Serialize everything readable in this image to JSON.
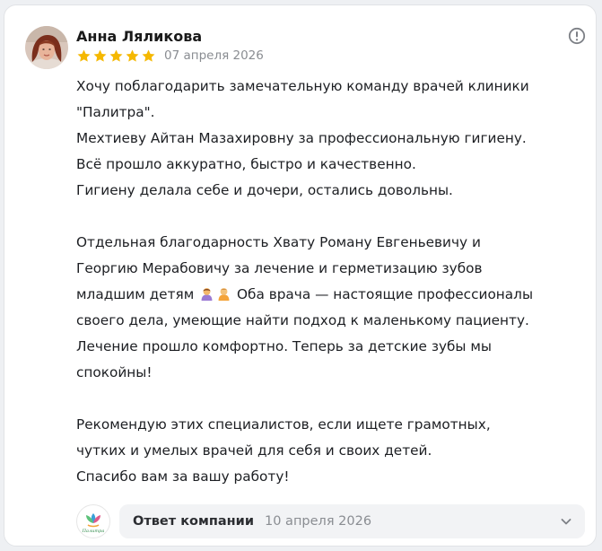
{
  "review": {
    "author": "Анна Ляликова",
    "rating": 5,
    "date": "07 апреля 2026",
    "paragraphs": [
      [
        "Хочу поблагодарить замечательную команду врачей клиники",
        "\"Палитра\".",
        "Мехтиеву Айтан Мазахировну за профессиональную гигиену.",
        "Всё прошло аккуратно, быстро и качественно.",
        "Гигиену делала себе и дочери, остались довольны."
      ],
      [
        "Отдельная благодарность Хвату Роману Евгеньевичу и",
        "Георгию Мерабовичу за лечение и герметизацию зубов",
        "младшим детям",
        "Оба врача — настоящие профессионалы",
        "своего дела, умеющие найти подход к маленькому пациенту.",
        "Лечение прошло комфортно. Теперь за детские зубы мы",
        "спокойны!"
      ],
      [
        "Рекомендую этих специалистов, если ищете грамотных,",
        "чутких и умелых врачей для себя и своих детей.",
        "Спасибо вам за вашу работу!"
      ]
    ]
  },
  "company_reply": {
    "label": "Ответ компании",
    "date": "10 апреля 2026",
    "logo_text": "Палитра"
  },
  "icons": {
    "info": "info-circle-icon",
    "star": "star-icon",
    "chevron": "chevron-down-icon",
    "emoji_1": "child-emoji-icon",
    "emoji_2": "baby-emoji-icon"
  },
  "colors": {
    "star": "#f5b800",
    "muted_text": "#8a8d92",
    "reply_bg": "#f2f3f5"
  }
}
